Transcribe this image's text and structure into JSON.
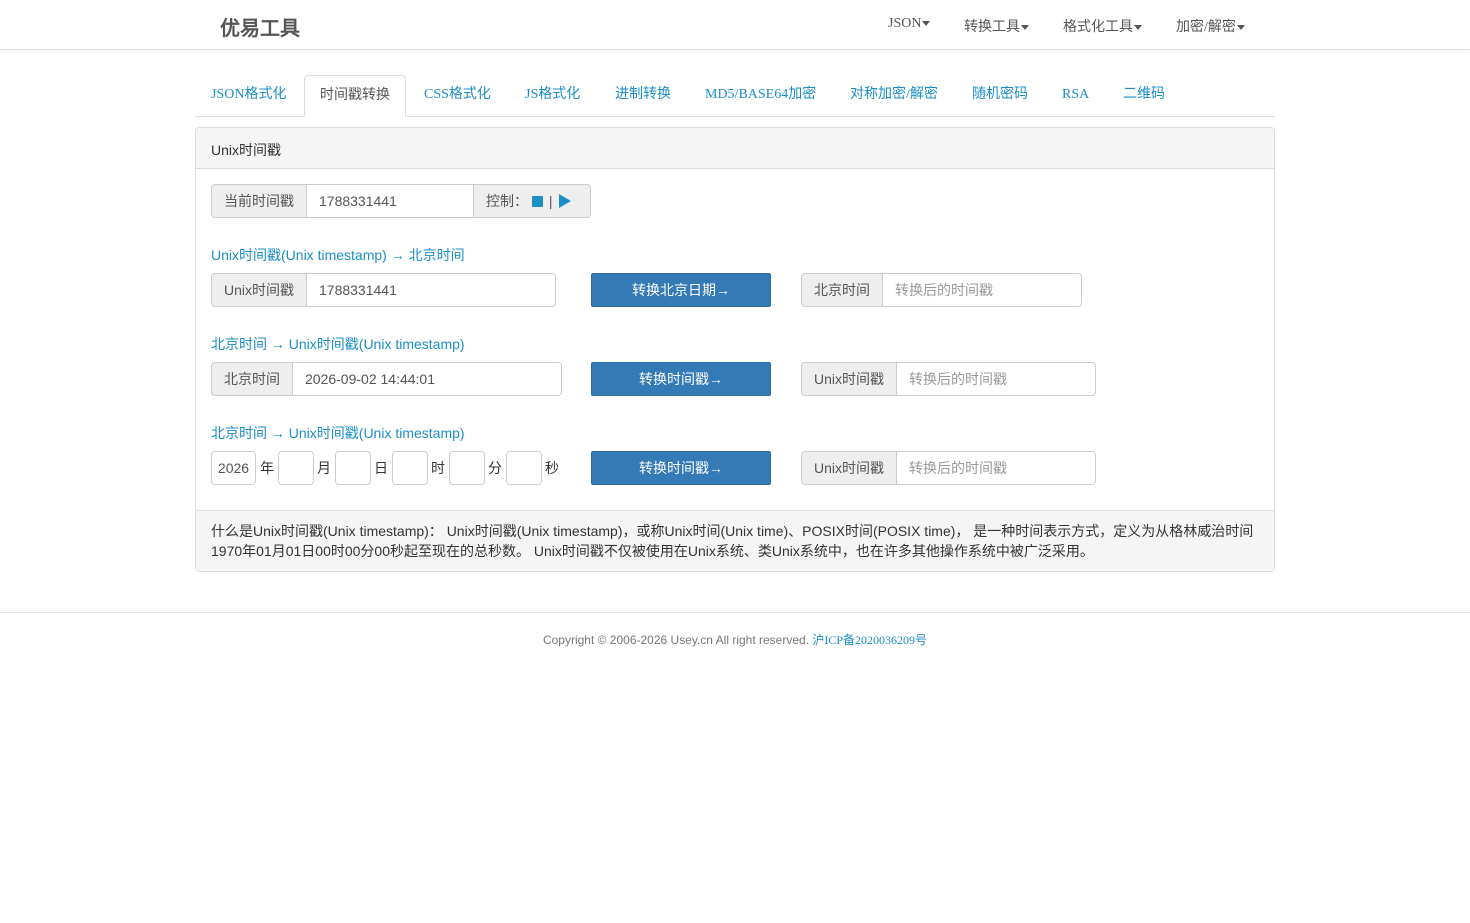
{
  "navbar": {
    "brand": "优易工具",
    "menu": [
      {
        "label": "JSON"
      },
      {
        "label": "转换工具"
      },
      {
        "label": "格式化工具"
      },
      {
        "label": "加密/解密"
      }
    ]
  },
  "tabs": [
    {
      "label": "JSON格式化"
    },
    {
      "label": "时间戳转换",
      "active": true
    },
    {
      "label": "CSS格式化"
    },
    {
      "label": "JS格式化"
    },
    {
      "label": "进制转换"
    },
    {
      "label": "MD5/BASE64加密"
    },
    {
      "label": "对称加密/解密"
    },
    {
      "label": "随机密码"
    },
    {
      "label": "RSA"
    },
    {
      "label": "二维码"
    }
  ],
  "panel": {
    "heading": "Unix时间戳",
    "current": {
      "label": "当前时间戳",
      "value": "1788331441",
      "control_label": "控制："
    },
    "section1": {
      "title": "Unix时间戳(Unix timestamp) → 北京时间",
      "input_label": "Unix时间戳",
      "input_value": "1788331441",
      "button": "转换北京日期→",
      "output_label": "北京时间",
      "output_placeholder": "转换后的时间戳"
    },
    "section2": {
      "title": "北京时间 → Unix时间戳(Unix timestamp)",
      "input_label": "北京时间",
      "input_value": "2026-09-02 14:44:01",
      "button": "转换时间戳→",
      "output_label": "Unix时间戳",
      "output_placeholder": "转换后的时间戳"
    },
    "section3": {
      "title": "北京时间 → Unix时间戳(Unix timestamp)",
      "year_value": "2026",
      "units": {
        "year": "年",
        "month": "月",
        "day": "日",
        "hour": "时",
        "minute": "分",
        "second": "秒"
      },
      "button": "转换时间戳→",
      "output_label": "Unix时间戳",
      "output_placeholder": "转换后的时间戳"
    },
    "footer_text": "什么是Unix时间戳(Unix timestamp)： Unix时间戳(Unix timestamp)，或称Unix时间(Unix time)、POSIX时间(POSIX time)， 是一种时间表示方式，定义为从格林威治时间1970年01月01日00时00分00秒起至现在的总秒数。 Unix时间戳不仅被使用在Unix系统、类Unix系统中，也在许多其他操作系统中被广泛采用。"
  },
  "footer": {
    "copyright": "Copyright © 2006-2026 Usey.cn All right reserved.",
    "icp": "沪ICP备2020036209号"
  },
  "colors": {
    "accent": "#1b8ec8",
    "button": "#337ab7"
  },
  "icons": [
    "caret-down-icon",
    "stop-icon",
    "play-icon"
  ]
}
